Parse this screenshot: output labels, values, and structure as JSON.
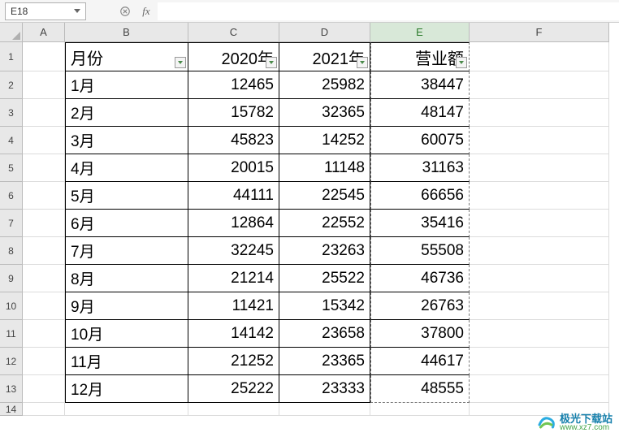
{
  "formula_bar": {
    "name_box_value": "E18",
    "fx_label": "fx"
  },
  "columns": [
    "A",
    "B",
    "C",
    "D",
    "E",
    "F"
  ],
  "selected_column": "E",
  "row_numbers": [
    "1",
    "2",
    "3",
    "4",
    "5",
    "6",
    "7",
    "8",
    "9",
    "10",
    "11",
    "12",
    "13",
    "14"
  ],
  "headers": {
    "B": "月份",
    "C": "2020年",
    "D": "2021年",
    "E": "营业额"
  },
  "rows": [
    {
      "month": "1月",
      "y2020": "12465",
      "y2021": "25982",
      "total": "38447"
    },
    {
      "month": "2月",
      "y2020": "15782",
      "y2021": "32365",
      "total": "48147"
    },
    {
      "month": "3月",
      "y2020": "45823",
      "y2021": "14252",
      "total": "60075"
    },
    {
      "month": "4月",
      "y2020": "20015",
      "y2021": "11148",
      "total": "31163"
    },
    {
      "month": "5月",
      "y2020": "44111",
      "y2021": "22545",
      "total": "66656"
    },
    {
      "month": "6月",
      "y2020": "12864",
      "y2021": "22552",
      "total": "35416"
    },
    {
      "month": "7月",
      "y2020": "32245",
      "y2021": "23263",
      "total": "55508"
    },
    {
      "month": "8月",
      "y2020": "21214",
      "y2021": "25522",
      "total": "46736"
    },
    {
      "month": "9月",
      "y2020": "11421",
      "y2021": "15342",
      "total": "26763"
    },
    {
      "month": "10月",
      "y2020": "14142",
      "y2021": "23658",
      "total": "37800"
    },
    {
      "month": "11月",
      "y2020": "21252",
      "y2021": "23365",
      "total": "44617"
    },
    {
      "month": "12月",
      "y2020": "25222",
      "y2021": "23333",
      "total": "48555"
    }
  ],
  "watermark": {
    "title": "极光下载站",
    "url": "www.xz7.com"
  }
}
